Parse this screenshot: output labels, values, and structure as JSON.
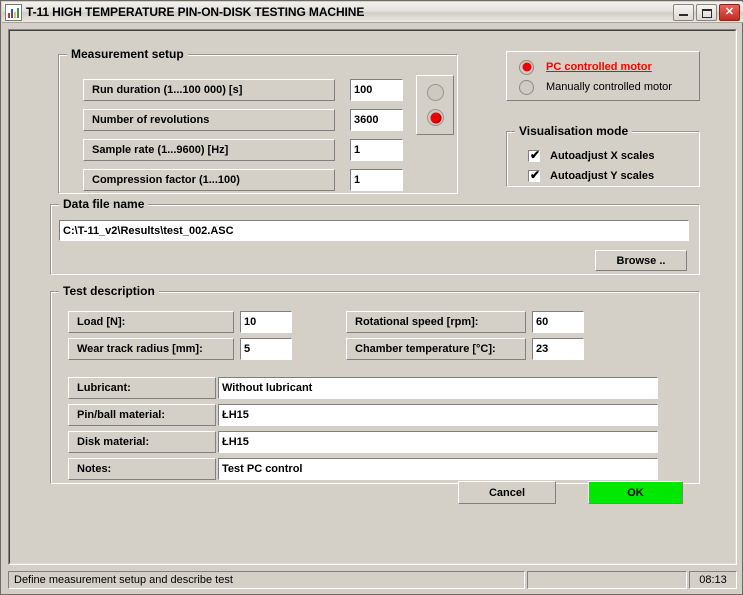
{
  "window": {
    "title": "T-11 HIGH TEMPERATURE PIN-ON-DISK TESTING MACHINE",
    "icon": "chart-icon",
    "buttons": {
      "minimize": "_",
      "maximize": "□",
      "close": "✕"
    }
  },
  "measurement_setup": {
    "legend": "Measurement setup",
    "rows": [
      {
        "label": "Run duration (1...100 000) [s]",
        "value": "100"
      },
      {
        "label": "Number of revolutions",
        "value": "3600"
      },
      {
        "label": "Sample rate (1...9600) [Hz]",
        "value": "1"
      },
      {
        "label": "Compression factor (1...100)",
        "value": "1"
      }
    ],
    "indicators": [
      {
        "name": "duration-led",
        "state": "off"
      },
      {
        "name": "revolutions-led",
        "state": "on"
      }
    ]
  },
  "motor_mode": {
    "options": [
      {
        "label": "PC controlled motor",
        "selected": true
      },
      {
        "label": "Manually controlled motor",
        "selected": false
      }
    ]
  },
  "visualisation_mode": {
    "legend": "Visualisation mode",
    "checkboxes": [
      {
        "label": "Autoadjust X scales",
        "checked": true,
        "mark": "✔"
      },
      {
        "label": "Autoadjust Y scales",
        "checked": true,
        "mark": "✔"
      }
    ]
  },
  "data_file": {
    "legend": "Data file name",
    "path": "C:\\T-11_v2\\Results\\test_002.ASC",
    "browse_label": "Browse .."
  },
  "test_description": {
    "legend": "Test description",
    "left_fields": [
      {
        "label": "Load [N]:",
        "value": "10"
      },
      {
        "label": "Wear track radius [mm]:",
        "value": "5"
      }
    ],
    "right_fields": [
      {
        "label": "Rotational speed [rpm]:",
        "value": "60"
      },
      {
        "label": "Chamber temperature [°C]:",
        "value": "23"
      }
    ],
    "wide_fields": [
      {
        "label": "Lubricant:",
        "value": "Without lubricant"
      },
      {
        "label": "Pin/ball material:",
        "value": "ŁH15"
      },
      {
        "label": "Disk material:",
        "value": "ŁH15"
      },
      {
        "label": "Notes:",
        "value": "Test PC control"
      }
    ]
  },
  "actions": {
    "cancel_label": "Cancel",
    "ok_label": "OK"
  },
  "statusbar": {
    "message": "Define measurement setup and describe test",
    "middle": "",
    "time": "08:13"
  },
  "colors": {
    "face": "#d4d0c8",
    "accent_red": "#ff0000",
    "ok_green": "#00e800"
  }
}
